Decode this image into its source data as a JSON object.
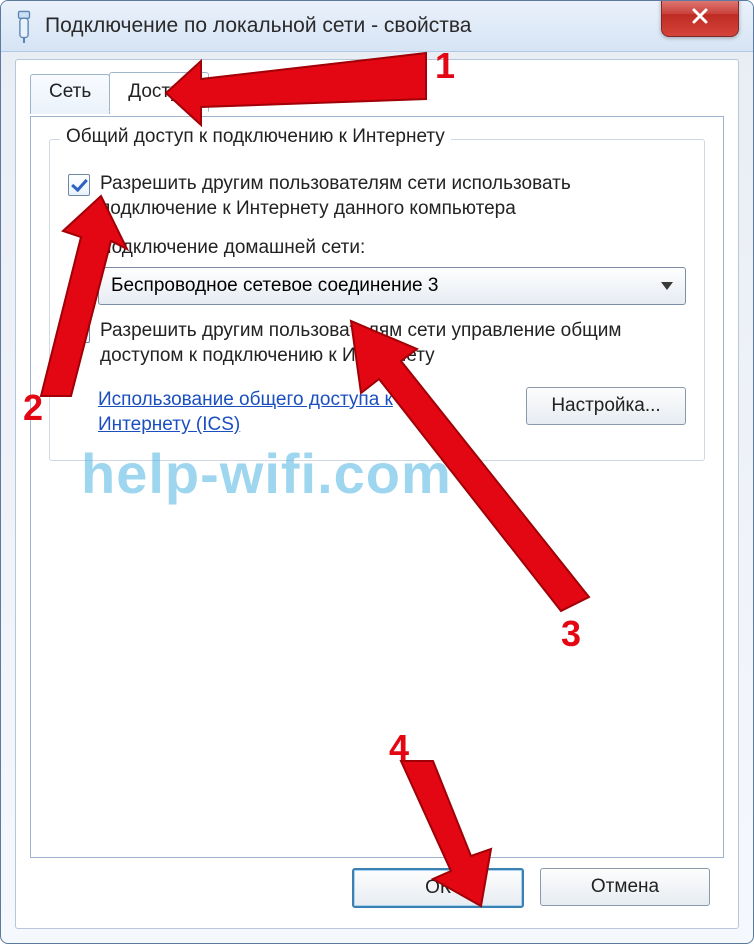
{
  "window": {
    "title": "Подключение по локальной сети - свойства"
  },
  "tabs": {
    "network": "Сеть",
    "sharing": "Доступ"
  },
  "group": {
    "title": "Общий доступ к подключению к Интернету",
    "allow_label": "Разрешить другим пользователям сети использовать подключение к Интернету данного компьютера",
    "home_connection_label": "Подключение домашней сети:",
    "combo_value": "Беспроводное сетевое соединение 3",
    "allow_control_label": "Разрешить другим пользователям сети управление общим доступом к подключению к Интернету",
    "ics_link": "Использование общего доступа к Интернету (ICS)",
    "settings_btn": "Настройка..."
  },
  "footer": {
    "ok": "ОК",
    "cancel": "Отмена"
  },
  "annotations": {
    "n1": "1",
    "n2": "2",
    "n3": "3",
    "n4": "4"
  },
  "watermark": "help-wifi.com"
}
